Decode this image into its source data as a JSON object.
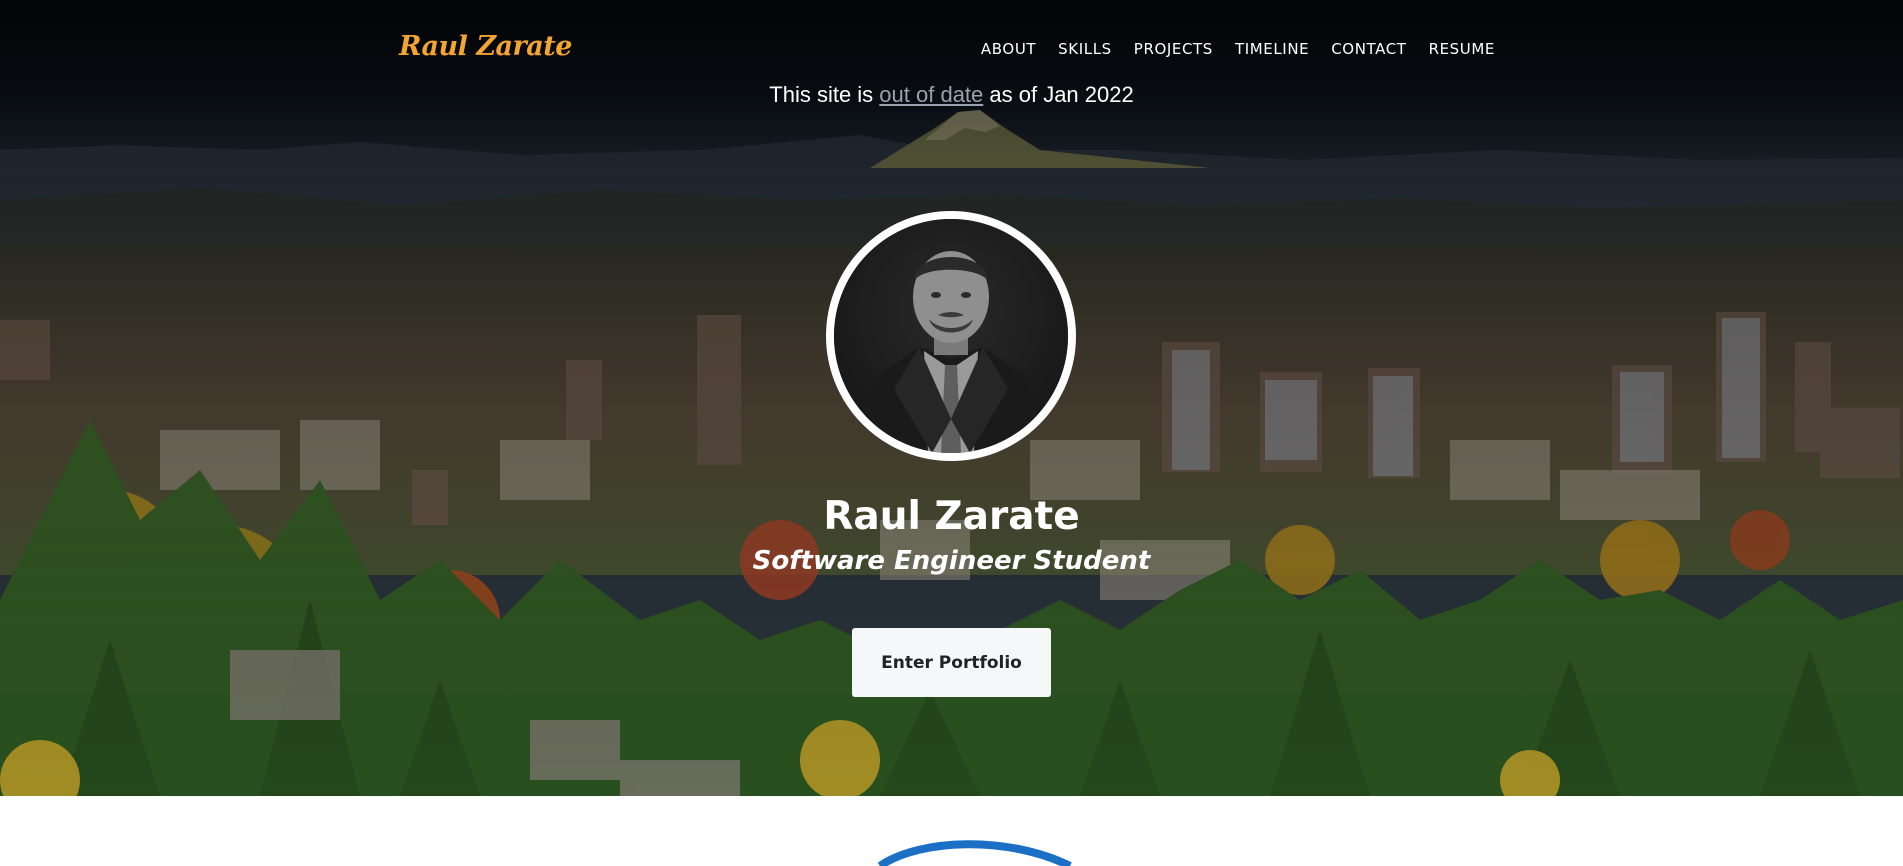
{
  "navbar": {
    "brand": "Raul Zarate",
    "links": [
      {
        "label": "ABOUT"
      },
      {
        "label": "SKILLS"
      },
      {
        "label": "PROJECTS"
      },
      {
        "label": "TIMELINE"
      },
      {
        "label": "CONTACT"
      },
      {
        "label": "RESUME"
      }
    ]
  },
  "notice": {
    "prefix": "This site is ",
    "link_text": "out of date",
    "suffix": " as of Jan 2022"
  },
  "hero": {
    "name": "Raul Zarate",
    "role": "Software Engineer Student",
    "button_label": "Enter Portfolio"
  },
  "colors": {
    "brand": "#f3a530",
    "nav_text": "#ffffff",
    "notice_link": "#9aa3ad",
    "button_bg": "#f6f7f8",
    "accent_logo_blue": "#1b6fc4"
  }
}
